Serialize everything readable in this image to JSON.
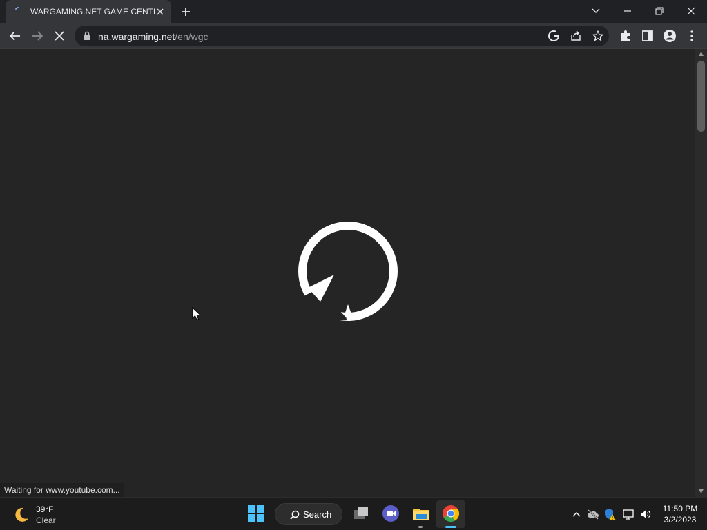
{
  "browser": {
    "tab": {
      "title": "WARGAMING.NET GAME CENTER",
      "favicon": "loading-favicon-icon"
    },
    "address": {
      "host": "na.wargaming.net",
      "path": "/en/wgc"
    },
    "status_text": "Waiting for www.youtube.com..."
  },
  "page": {
    "state": "loading",
    "spinner_icon": "wargaming-refresh-spinner-icon",
    "background": "#252525"
  },
  "taskbar": {
    "weather": {
      "temp": "39°F",
      "desc": "Clear",
      "icon": "moon-icon"
    },
    "search_label": "Search",
    "clock": {
      "time": "11:50 PM",
      "date": "3/2/2023"
    }
  },
  "colors": {
    "tab_strip": "#202124",
    "toolbar": "#35363a",
    "accent_blue": "#4cc2ff",
    "chrome_red": "#ea4335",
    "chrome_green": "#34a853",
    "chrome_yellow": "#fbbc05",
    "chrome_blue": "#4285f4"
  }
}
